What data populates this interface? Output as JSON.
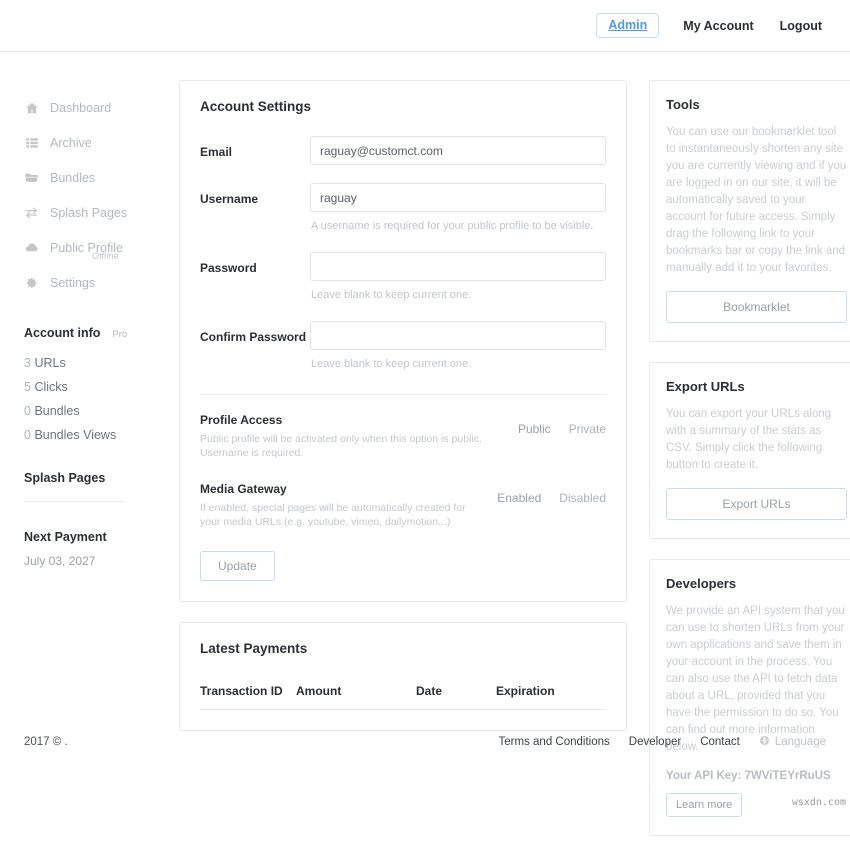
{
  "topbar": {
    "admin_label": "Admin",
    "my_account_label": "My Account",
    "logout_label": "Logout"
  },
  "sidebar": {
    "nav": [
      {
        "label": "Dashboard",
        "icon": "home-icon"
      },
      {
        "label": "Archive",
        "icon": "list-icon"
      },
      {
        "label": "Bundles",
        "icon": "folder-icon"
      },
      {
        "label": "Splash Pages",
        "icon": "exchange-icon"
      },
      {
        "label": "Public Profile",
        "icon": "cloud-icon",
        "sub": "Offline"
      },
      {
        "label": "Settings",
        "icon": "gear-icon"
      }
    ],
    "account_info": {
      "title": "Account info",
      "badge": "Pro",
      "stats": [
        {
          "num": "3",
          "label": "URLs"
        },
        {
          "num": "5",
          "label": "Clicks"
        },
        {
          "num": "0",
          "label": "Bundles"
        },
        {
          "num": "0",
          "label": "Bundles Views"
        }
      ]
    },
    "splash_pages_title": "Splash Pages",
    "next_payment_title": "Next Payment",
    "next_payment_date": "July 03, 2027"
  },
  "account_settings": {
    "title": "Account Settings",
    "email": {
      "label": "Email",
      "value": "raguay@customct.com",
      "placeholder": ""
    },
    "username": {
      "label": "Username",
      "value": "raguay",
      "placeholder": "",
      "hint": "A username is required for your public profile to be visible."
    },
    "password": {
      "label": "Password",
      "value": "",
      "placeholder": "",
      "hint": "Leave blank to keep current one."
    },
    "confirm_password": {
      "label": "Confirm Password",
      "value": "",
      "placeholder": "",
      "hint": "Leave blank to keep current one."
    },
    "profile_access": {
      "title": "Profile Access",
      "desc": "Public profile will be activated only when this option is public. Username is required.",
      "option_public": "Public",
      "option_private": "Private"
    },
    "media_gateway": {
      "title": "Media Gateway",
      "desc": "If enabled, special pages will be automatically created for your media URLs (e.g. youtube, vimeo, dailymotion...)",
      "option_enabled": "Enabled",
      "option_disabled": "Disabled"
    },
    "update_label": "Update"
  },
  "latest_payments": {
    "title": "Latest Payments",
    "columns": [
      "Transaction ID",
      "Amount",
      "Date",
      "Expiration"
    ],
    "rows": []
  },
  "tools": {
    "title": "Tools",
    "body": "You can use our bookmarklet tool to instantaneously shorten any site you are currently viewing and if you are logged in on our site, it will be automatically saved to your account for future access. Simply drag the following link to your bookmarks bar or copy the link and manually add it to your favorites.",
    "button_label": "Bookmarklet"
  },
  "export_urls": {
    "title": "Export URLs",
    "body": "You can export your URLs along with a summary of the stats as CSV. Simply click the following button to create it.",
    "button_label": "Export URLs"
  },
  "developers": {
    "title": "Developers",
    "body": "We provide an API system that you can use to shorten URLs from your own applications and save them in your account in the process. You can also use the API to fetch data about a URL, provided that you have the permission to do so. You can find out more information below.",
    "api_key_line": "Your API Key: 7WViTEYrRuUS",
    "button_label": "Learn more"
  },
  "footer": {
    "copyright": "2017 © .",
    "links": [
      "Terms and Conditions",
      "Developer",
      "Contact"
    ],
    "language_label": "Language"
  },
  "watermark": "wsxdn.com",
  "colors": {
    "accent": "#4a9ae8",
    "accent_border": "#c3ddf5",
    "text_dark": "#2b2f33",
    "text_muted": "#c4c8cc",
    "card_border": "#e7e9eb"
  }
}
